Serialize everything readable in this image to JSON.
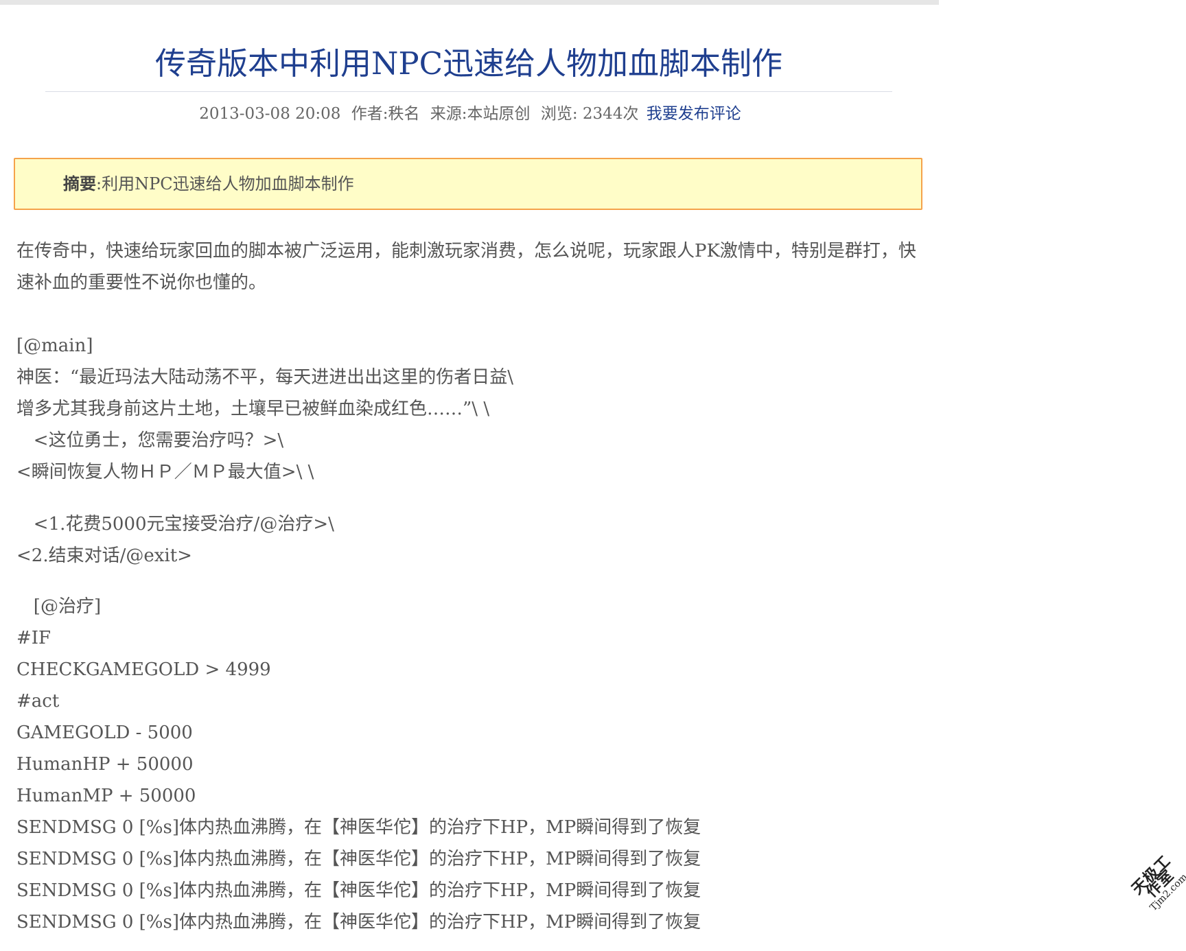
{
  "article": {
    "title": "传奇版本中利用NPC迅速给人物加血脚本制作",
    "meta": {
      "datetime": "2013-03-08 20:08",
      "author": "作者:秩名",
      "source": "来源:本站原创",
      "views": "浏览: 2344次",
      "comment_link": "我要发布评论"
    },
    "summary": {
      "label": "摘要",
      "text": ":利用NPC迅速给人物加血脚本制作"
    },
    "intro": "在传奇中，快速给玩家回血的脚本被广泛运用，能刺激玩家消费，怎么说呢，玩家跟人PK激情中，特别是群打，快速补血的重要性不说你也懂的。",
    "script_lines": [
      "[@main]",
      "神医：“最近玛法大陆动荡不平，每天进进出出这里的伤者日益\\",
      "增多尤其我身前这片土地，土壤早已被鲜血染成红色……”\\ \\",
      "   <这位勇士，您需要治疗吗？>\\",
      "<瞬间恢复人物ＨＰ／ＭＰ最大值>\\ \\",
      "   <1.花费5000元宝接受治疗/@治疗>\\",
      "<2.结束对话/@exit>",
      "   [@治疗]",
      "#IF",
      "CHECKGAMEGOLD > 4999",
      "#act",
      "GAMEGOLD - 5000",
      "HumanHP + 50000",
      "HumanMP + 50000",
      "SENDMSG 0 [%s]体内热血沸腾，在【神医华佗】的治疗下HP，MP瞬间得到了恢复",
      "SENDMSG 0 [%s]体内热血沸腾，在【神医华佗】的治疗下HP，MP瞬间得到了恢复",
      "SENDMSG 0 [%s]体内热血沸腾，在【神医华佗】的治疗下HP，MP瞬间得到了恢复",
      "SENDMSG 0 [%s]体内热血沸腾，在【神医华佗】的治疗下HP，MP瞬间得到了恢复"
    ]
  },
  "watermark": {
    "main": "天极工作室",
    "sub": "Tjm2.com"
  },
  "colors": {
    "title": "#1f3f8f",
    "summary_bg": "#fffdc8",
    "summary_border": "#f5a24a",
    "body_text": "#555555"
  }
}
